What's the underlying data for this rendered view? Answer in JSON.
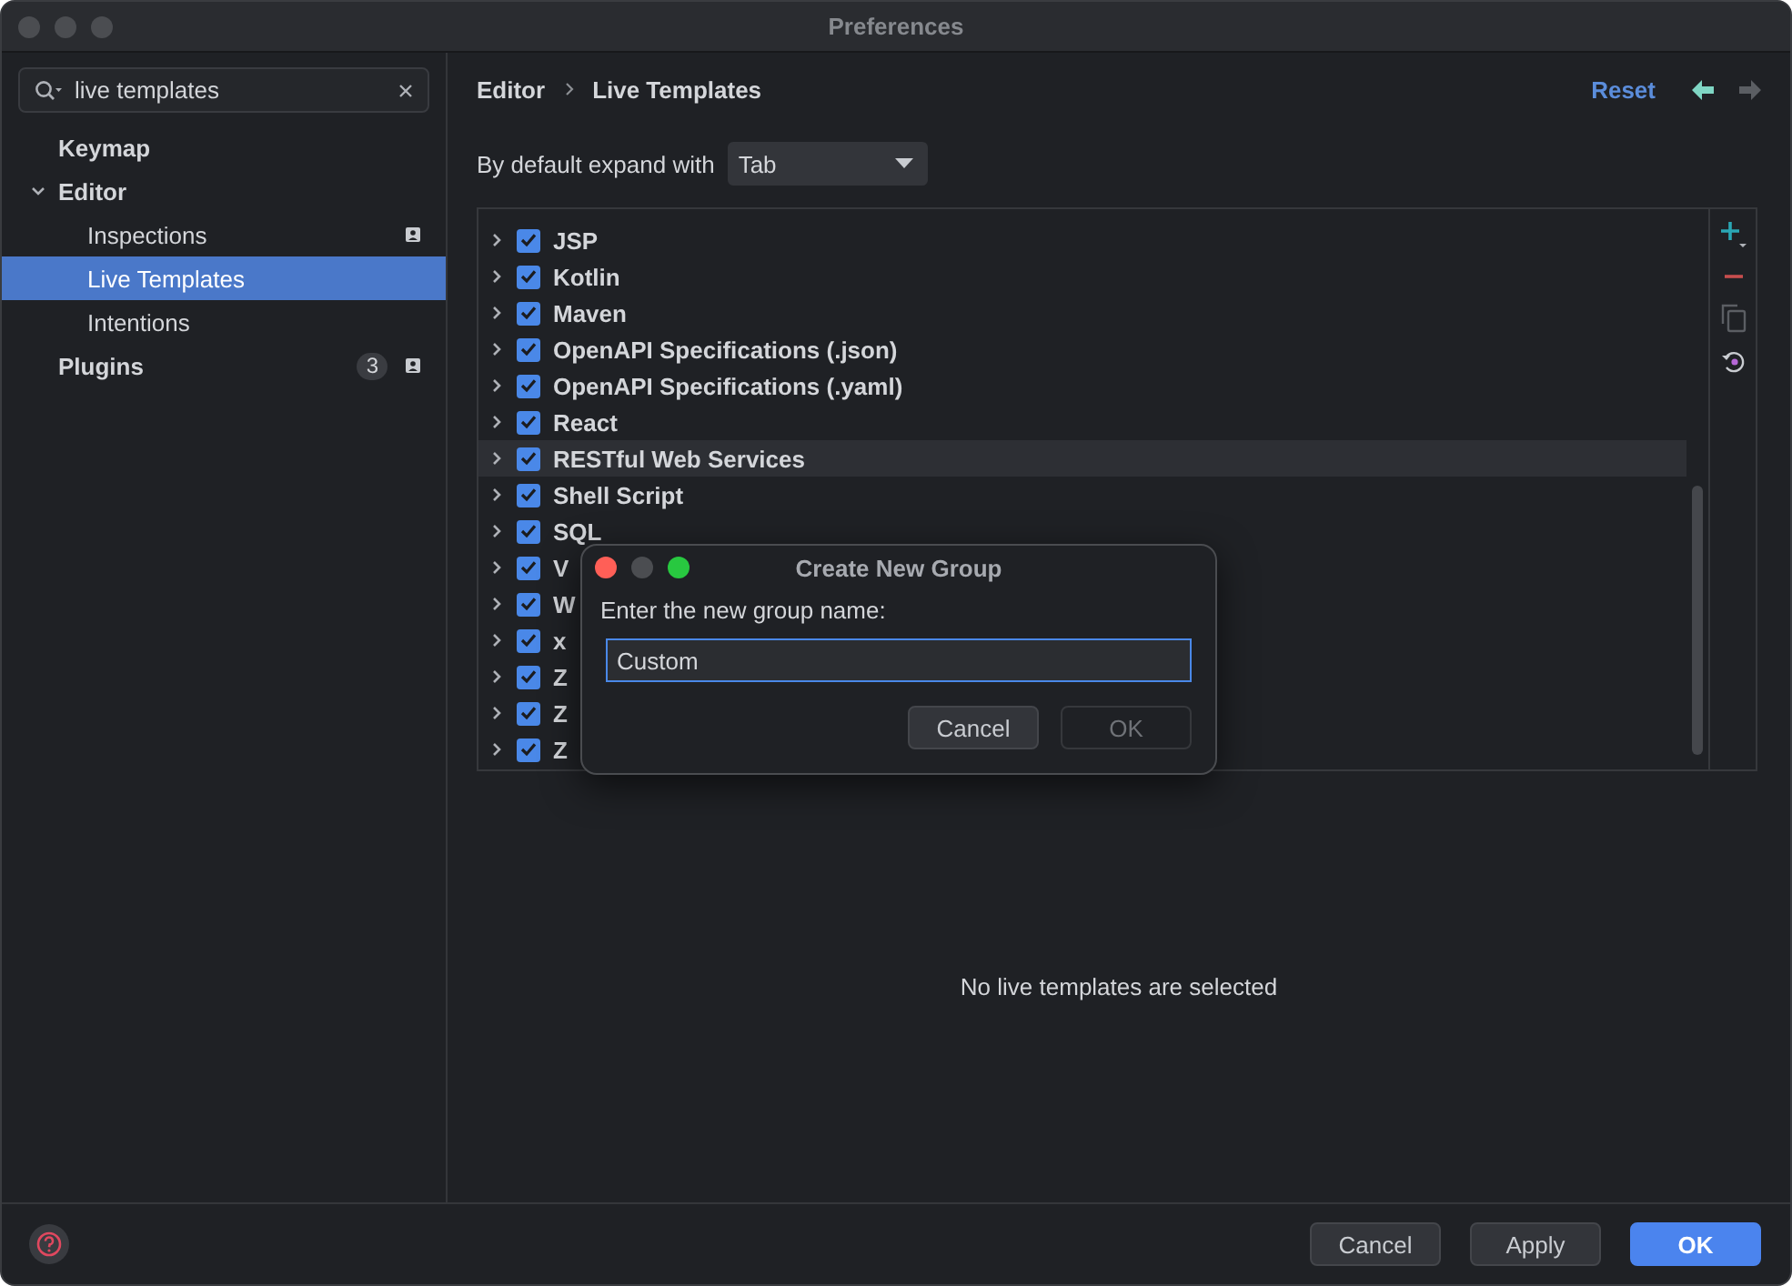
{
  "window": {
    "title": "Preferences"
  },
  "search": {
    "value": "live templates"
  },
  "sidebar": {
    "items": [
      {
        "label": "Keymap",
        "selected": false
      },
      {
        "label": "Editor",
        "selected": false,
        "expanded": true,
        "children": [
          {
            "label": "Inspections",
            "selected": false,
            "profile_marker": true
          },
          {
            "label": "Live Templates",
            "selected": true,
            "profile_marker": false
          },
          {
            "label": "Intentions",
            "selected": false,
            "profile_marker": false
          }
        ]
      },
      {
        "label": "Plugins",
        "selected": false,
        "badge": "3",
        "profile_marker": true
      }
    ]
  },
  "breadcrumb": [
    "Editor",
    "Live Templates"
  ],
  "reset": "Reset",
  "navigation": {
    "back_enabled": true,
    "forward_enabled": false
  },
  "expand_with": {
    "label": "By default expand with",
    "value": "Tab"
  },
  "template_groups": [
    {
      "label": "JSP",
      "checked": true,
      "selected": false
    },
    {
      "label": "Kotlin",
      "checked": true,
      "selected": false
    },
    {
      "label": "Maven",
      "checked": true,
      "selected": false
    },
    {
      "label": "OpenAPI Specifications (.json)",
      "checked": true,
      "selected": false
    },
    {
      "label": "OpenAPI Specifications (.yaml)",
      "checked": true,
      "selected": false
    },
    {
      "label": "React",
      "checked": true,
      "selected": false
    },
    {
      "label": "RESTful Web Services",
      "checked": true,
      "selected": true
    },
    {
      "label": "Shell Script",
      "checked": true,
      "selected": false
    },
    {
      "label": "SQL",
      "checked": true,
      "selected": false
    },
    {
      "label": "V",
      "checked": true,
      "selected": false
    },
    {
      "label": "W",
      "checked": true,
      "selected": false
    },
    {
      "label": "x",
      "checked": true,
      "selected": false
    },
    {
      "label": "Z",
      "checked": true,
      "selected": false
    },
    {
      "label": "Z",
      "checked": true,
      "selected": false
    },
    {
      "label": "Z",
      "checked": true,
      "selected": false
    }
  ],
  "empty_message": "No live templates are selected",
  "footer_buttons": [
    {
      "label": "Cancel",
      "primary": false
    },
    {
      "label": "Apply",
      "primary": false
    },
    {
      "label": "OK",
      "primary": true
    }
  ],
  "dialog": {
    "title": "Create New Group",
    "prompt": "Enter the new group name:",
    "value": "Custom",
    "buttons": [
      {
        "label": "Cancel",
        "disabled": false
      },
      {
        "label": "OK",
        "disabled": true
      }
    ]
  }
}
